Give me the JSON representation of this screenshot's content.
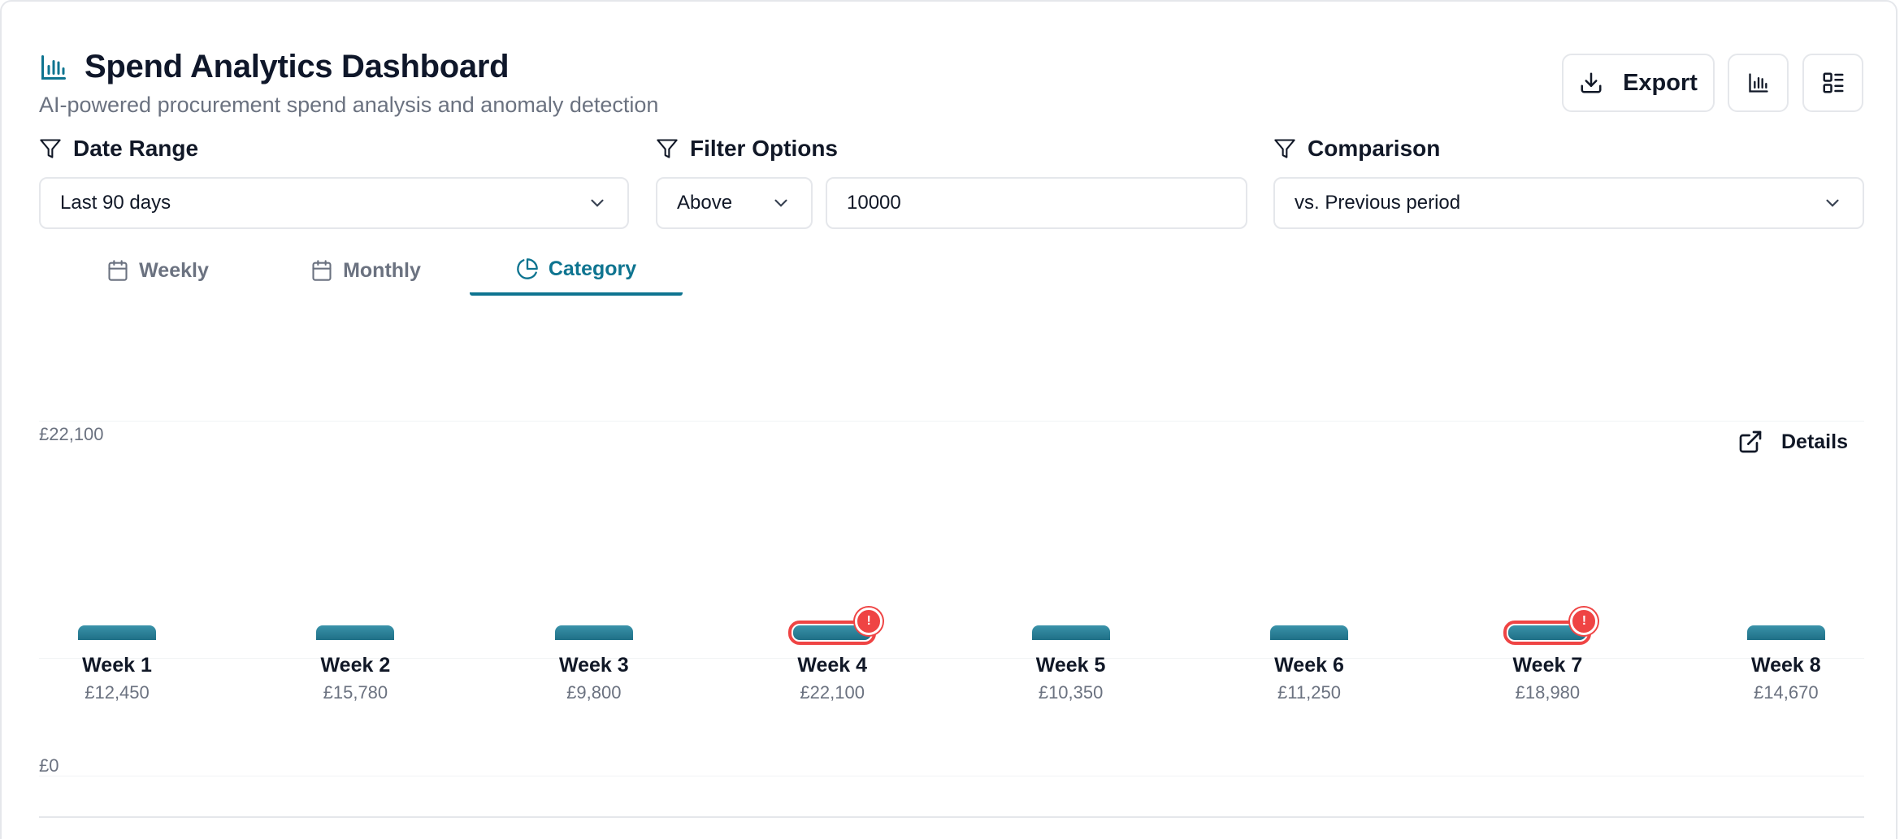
{
  "header": {
    "title": "Spend Analytics Dashboard",
    "subtitle": "AI-powered procurement spend analysis and anomaly detection",
    "export_label": "Export"
  },
  "filters": {
    "date_range": {
      "label": "Date Range",
      "value": "Last 90 days"
    },
    "filter_options": {
      "label": "Filter Options",
      "operator": "Above",
      "amount": "10000"
    },
    "comparison": {
      "label": "Comparison",
      "value": "vs. Previous period"
    }
  },
  "tabs": [
    {
      "label": "Weekly",
      "active": false
    },
    {
      "label": "Monthly",
      "active": false
    },
    {
      "label": "Category",
      "active": true
    }
  ],
  "chart": {
    "details_label": "Details",
    "y_max_label": "£22,100",
    "y_min_label": "£0"
  },
  "colors": {
    "accent": "#0e7490",
    "bar": "#2b7f97",
    "anomaly": "#ef4444"
  },
  "chart_data": {
    "type": "bar",
    "categories": [
      "Week 1",
      "Week 2",
      "Week 3",
      "Week 4",
      "Week 5",
      "Week 6",
      "Week 7",
      "Week 8"
    ],
    "values": [
      12450,
      15780,
      9800,
      22100,
      10350,
      11250,
      18980,
      14670
    ],
    "value_labels": [
      "£12,450",
      "£15,780",
      "£9,800",
      "£22,100",
      "£10,350",
      "£11,250",
      "£18,980",
      "£14,670"
    ],
    "anomalies": [
      false,
      false,
      false,
      true,
      false,
      false,
      true,
      false
    ],
    "ylim": [
      0,
      22100
    ],
    "grid": true
  }
}
